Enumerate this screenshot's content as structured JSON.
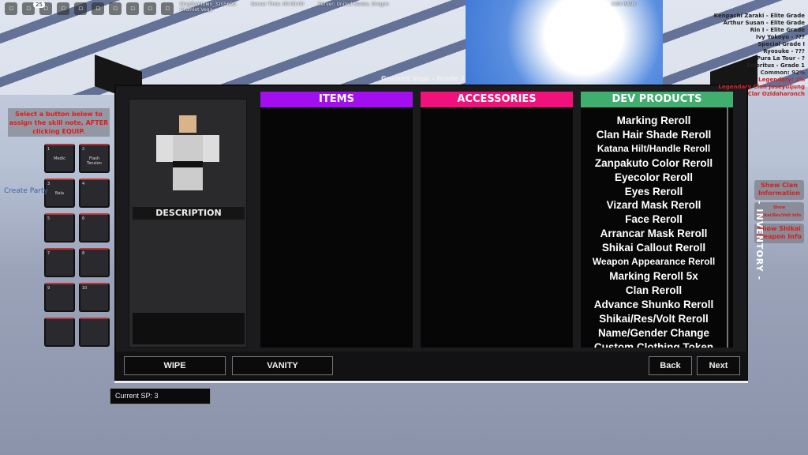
{
  "topbar": {
    "notification_count": "25",
    "icons": [
      "roblox-menu-icon",
      "chat-icon",
      "backpack-icon",
      "camera-icon",
      "record-icon",
      "menu-icon",
      "phone-icon",
      "volume-icon",
      "settings-icon",
      "keyboard-icon"
    ],
    "player_info": "Kingdomtown_3205690",
    "player_name": "Grumlet Vega",
    "server_time": "Server Time: 00:00:00",
    "server_info": "Server: United States, Oregon"
  },
  "rank": {
    "label": "CAN RANK"
  },
  "panel": {
    "title": "Grumlet Vega - Grade 3",
    "description_label": "DESCRIPTION",
    "columns": [
      {
        "label": "ITEMS",
        "color": "#a20ef0",
        "items": []
      },
      {
        "label": "ACCESSORIES",
        "color": "#f0127a",
        "items": []
      },
      {
        "label": "DEV PRODUCTS",
        "color": "#3fae6e",
        "items": [
          "Marking Reroll",
          "Clan Hair Shade Reroll",
          "Katana Hilt/Handle Reroll",
          "Zanpakuto Color Reroll",
          "Eyecolor Reroll",
          "Eyes Reroll",
          "Vizard Mask Reroll",
          "Face Reroll",
          "Arrancar Mask Reroll",
          "Shikai Callout Reroll",
          "Weapon Appearance Reroll",
          "Marking Reroll 5x",
          "Clan Reroll",
          "Advance Shunko Reroll",
          "Shikai/Res/Volt Reroll",
          "Name/Gender Change",
          "Custom Clothing Token"
        ]
      }
    ],
    "buttons": {
      "wipe": "WIPE",
      "vanity": "VANITY",
      "back": "Back",
      "next": "Next"
    }
  },
  "current_sp": "Current SP: 3",
  "skills": {
    "instruction": "Select a button below to assign the skill note, AFTER clicking EQUIP.",
    "slots": [
      {
        "n": "1",
        "label": "Medic"
      },
      {
        "n": "2",
        "label": "Flash Tension"
      },
      {
        "n": "3",
        "label": "Bala"
      },
      {
        "n": "4",
        "label": ""
      },
      {
        "n": "5",
        "label": ""
      },
      {
        "n": "6",
        "label": ""
      },
      {
        "n": "7",
        "label": ""
      },
      {
        "n": "8",
        "label": ""
      },
      {
        "n": "9",
        "label": ""
      },
      {
        "n": "10",
        "label": ""
      },
      {
        "n": "",
        "label": ""
      },
      {
        "n": "",
        "label": ""
      }
    ]
  },
  "create_party": "Create Party",
  "right_info": {
    "lines": [
      "Kenpachi Zaraki - Elite Grade",
      "Arthur Susan - Elite Grade",
      "Rin I - Elite Grade",
      "Ivy Yokoyo - ???",
      "Special Grade I",
      "Ryosuke - ???",
      "Pura La Tour - ?",
      "Emeritus - Grade 1"
    ],
    "rarity_common": "Common: 92%",
    "rarity_legendary": "Legendary: 2%",
    "clan_lines": "Legendary Clan Joseyuljung Clar Ozidaharonch"
  },
  "right_buttons": [
    "Show Clan Information",
    "Show Shikai/Res/Volt Info",
    "Show Shikai Weapon Info"
  ],
  "inventory_label": "- INVENTORY -"
}
